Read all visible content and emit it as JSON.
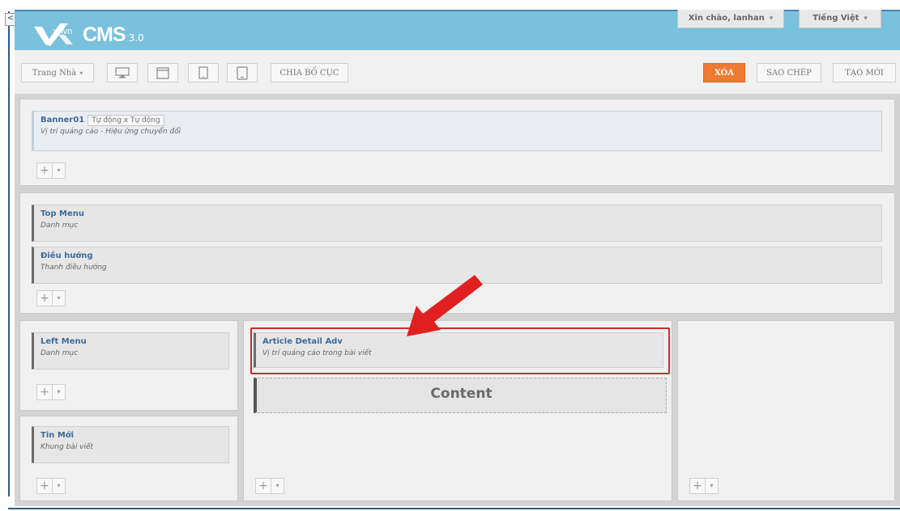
{
  "window": {
    "collapse_glyph": "<"
  },
  "header": {
    "logo": {
      "mark": "vnvn",
      "title": "CMS",
      "version": "3.0"
    },
    "greeting": "Xin chào, lanhan",
    "language": "Tiếng Việt"
  },
  "toolbar": {
    "page_select": "Trang Nhà",
    "devices": [
      "desktop-icon",
      "browser-window-icon",
      "tablet-icon",
      "tablet-landscape-icon"
    ],
    "split_layout": "CHIA BỐ CỤC",
    "delete": "XÓA",
    "copy": "SAO CHÉP",
    "create_new": "TẠO MỚI",
    "accent_color": "#ee7a33"
  },
  "zones": {
    "banner": {
      "module": {
        "title": "Banner01",
        "badge": "Tự động x Tự động",
        "subtitle": "Vị trí quảng cáo - Hiệu ứng chuyển đổi"
      }
    },
    "menu_zone": {
      "modules": [
        {
          "title": "Top Menu",
          "subtitle": "Danh mục"
        },
        {
          "title": "Điều hướng",
          "subtitle": "Thanh điều hướng"
        }
      ]
    },
    "left": {
      "modules": [
        {
          "title": "Left Menu",
          "subtitle": "Danh mục"
        },
        {
          "title": "Tin Mới",
          "subtitle": "Khung bài viết"
        }
      ]
    },
    "center": {
      "module": {
        "title": "Article Detail Adv",
        "subtitle": "Vị trí quảng cáo trong bài viết"
      },
      "content_label": "Content",
      "highlight_color": "#cc2c2c"
    }
  },
  "add_button": {
    "plus": "+",
    "caret": "▾"
  }
}
